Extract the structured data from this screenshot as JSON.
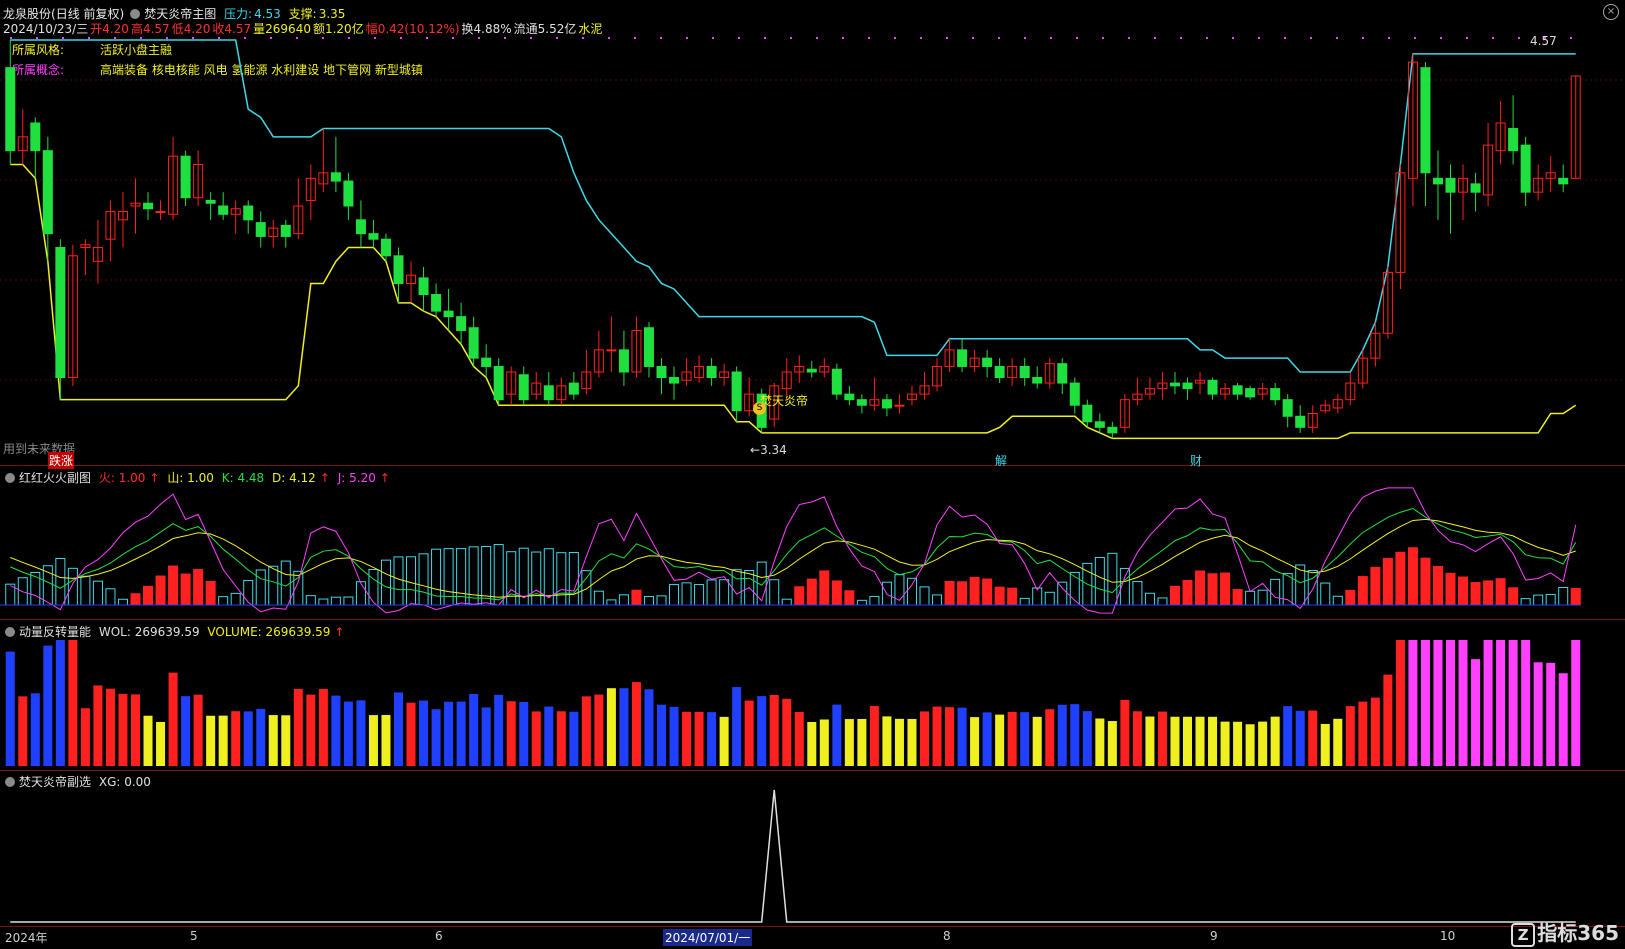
{
  "header": {
    "stock_name": "龙泉股份",
    "period": "(日线 前复权)",
    "indicator": "焚天炎帝主图",
    "pressure_label": "压力:",
    "pressure_value": "4.53",
    "support_label": "支撑:",
    "support_value": "3.35"
  },
  "quote": {
    "date": "2024/10/23/三",
    "open": "开4.20",
    "high": "高4.57",
    "low": "低4.20",
    "close": "收4.57",
    "volume": "量269640",
    "amount": "额1.20亿",
    "change": "幅0.42(10.12%)",
    "turnover": "换4.88%",
    "float": "流通5.52亿",
    "industry": "水泥"
  },
  "info": {
    "style_label": "所属风格:",
    "style_value": "活跃小盘主融",
    "concept_label": "所属概念:",
    "concept_value": "高端装备 核电核能 风电 氢能源 水利建设 地下管网 新型城镇"
  },
  "annotations": {
    "price_high": "4.57",
    "price_low": "3.34",
    "signal_text": "焚天炎帝",
    "future_data": "用到未来数据",
    "tag_zhangdie": "跌涨",
    "tag_jie": "解",
    "tag_cai": "财",
    "marker_s": "S"
  },
  "sub1": {
    "title": "红红火火副图",
    "huo": "火: 1.00",
    "shan": "山: 1.00",
    "k": "K: 4.48",
    "d": "D: 4.12",
    "j": "J: 5.20"
  },
  "sub2": {
    "title": "动量反转量能",
    "wol": "WOL: 269639.59",
    "volume": "VOLUME: 269639.59"
  },
  "sub3": {
    "title": "焚天炎帝副选",
    "xg": "XG: 0.00"
  },
  "xaxis": {
    "labels": [
      "2024年",
      "5",
      "6",
      "2024/07/01/一",
      "8",
      "9",
      "10"
    ]
  },
  "brand": {
    "logo_letter": "Z",
    "name": "指标365"
  },
  "colors": {
    "up": "#ff2020",
    "down": "#20e040",
    "cyan_line": "#40d8e8",
    "yellow_line": "#f0f020",
    "magenta": "#ff40ff",
    "border": "#7a1010"
  },
  "chart_data": {
    "type": "candlestick",
    "title": "",
    "ylim": [
      3.2,
      4.7
    ],
    "candles": [
      [
        4.6,
        4.3,
        4.7,
        4.25
      ],
      [
        4.3,
        4.35,
        4.45,
        4.25
      ],
      [
        4.4,
        4.3,
        4.42,
        4.2
      ],
      [
        4.3,
        4.0,
        4.35,
        3.9
      ],
      [
        3.95,
        3.48,
        3.98,
        3.4
      ],
      [
        3.48,
        3.92,
        3.96,
        3.45
      ],
      [
        3.95,
        3.96,
        3.98,
        3.85
      ],
      [
        3.9,
        3.95,
        4.05,
        3.82
      ],
      [
        3.98,
        4.08,
        4.12,
        3.9
      ],
      [
        4.05,
        4.08,
        4.15,
        3.95
      ],
      [
        4.1,
        4.11,
        4.2,
        4.0
      ],
      [
        4.11,
        4.09,
        4.15,
        4.05
      ],
      [
        4.08,
        4.08,
        4.12,
        4.05
      ],
      [
        4.07,
        4.28,
        4.35,
        4.05
      ],
      [
        4.28,
        4.13,
        4.3,
        4.1
      ],
      [
        4.13,
        4.25,
        4.3,
        4.1
      ],
      [
        4.12,
        4.11,
        4.15,
        4.05
      ],
      [
        4.1,
        4.07,
        4.15,
        4.05
      ],
      [
        4.07,
        4.09,
        4.12,
        4.0
      ],
      [
        4.1,
        4.05,
        4.12,
        4.0
      ],
      [
        4.04,
        3.99,
        4.08,
        3.95
      ],
      [
        3.99,
        4.02,
        4.05,
        3.95
      ],
      [
        4.03,
        3.99,
        4.05,
        3.95
      ],
      [
        4.0,
        4.1,
        4.2,
        3.98
      ],
      [
        4.12,
        4.2,
        4.25,
        4.05
      ],
      [
        4.18,
        4.22,
        4.38,
        4.15
      ],
      [
        4.22,
        4.19,
        4.35,
        4.15
      ],
      [
        4.19,
        4.1,
        4.22,
        4.05
      ],
      [
        4.05,
        4.0,
        4.12,
        3.95
      ],
      [
        4.0,
        3.98,
        4.05,
        3.95
      ],
      [
        3.98,
        3.92,
        4.0,
        3.9
      ],
      [
        3.92,
        3.82,
        3.95,
        3.75
      ],
      [
        3.82,
        3.85,
        3.9,
        3.75
      ],
      [
        3.84,
        3.78,
        3.88,
        3.72
      ],
      [
        3.78,
        3.72,
        3.82,
        3.7
      ],
      [
        3.72,
        3.7,
        3.8,
        3.65
      ],
      [
        3.7,
        3.65,
        3.75,
        3.6
      ],
      [
        3.66,
        3.55,
        3.7,
        3.52
      ],
      [
        3.55,
        3.52,
        3.6,
        3.48
      ],
      [
        3.52,
        3.4,
        3.55,
        3.38
      ],
      [
        3.42,
        3.5,
        3.52,
        3.38
      ],
      [
        3.49,
        3.4,
        3.52,
        3.38
      ],
      [
        3.42,
        3.46,
        3.5,
        3.4
      ],
      [
        3.45,
        3.4,
        3.5,
        3.38
      ],
      [
        3.4,
        3.45,
        3.48,
        3.38
      ],
      [
        3.46,
        3.42,
        3.5,
        3.4
      ],
      [
        3.44,
        3.5,
        3.58,
        3.42
      ],
      [
        3.5,
        3.58,
        3.65,
        3.48
      ],
      [
        3.58,
        3.58,
        3.7,
        3.5
      ],
      [
        3.58,
        3.5,
        3.65,
        3.45
      ],
      [
        3.5,
        3.65,
        3.7,
        3.48
      ],
      [
        3.66,
        3.52,
        3.68,
        3.48
      ],
      [
        3.52,
        3.48,
        3.55,
        3.42
      ],
      [
        3.48,
        3.46,
        3.52,
        3.4
      ],
      [
        3.47,
        3.5,
        3.55,
        3.45
      ],
      [
        3.48,
        3.52,
        3.56,
        3.46
      ],
      [
        3.52,
        3.48,
        3.55,
        3.45
      ],
      [
        3.48,
        3.5,
        3.53,
        3.45
      ],
      [
        3.5,
        3.36,
        3.52,
        3.32
      ],
      [
        3.36,
        3.42,
        3.48,
        3.34
      ],
      [
        3.42,
        3.3,
        3.44,
        3.28
      ],
      [
        3.33,
        3.45,
        3.46,
        3.3
      ],
      [
        3.44,
        3.5,
        3.55,
        3.4
      ],
      [
        3.5,
        3.52,
        3.56,
        3.46
      ],
      [
        3.51,
        3.5,
        3.54,
        3.48
      ],
      [
        3.5,
        3.52,
        3.55,
        3.48
      ],
      [
        3.51,
        3.42,
        3.53,
        3.4
      ],
      [
        3.42,
        3.4,
        3.45,
        3.38
      ],
      [
        3.4,
        3.38,
        3.42,
        3.35
      ],
      [
        3.38,
        3.4,
        3.48,
        3.36
      ],
      [
        3.4,
        3.37,
        3.42,
        3.34
      ],
      [
        3.38,
        3.38,
        3.42,
        3.35
      ],
      [
        3.4,
        3.42,
        3.45,
        3.38
      ],
      [
        3.42,
        3.45,
        3.5,
        3.4
      ],
      [
        3.45,
        3.52,
        3.55,
        3.43
      ],
      [
        3.52,
        3.58,
        3.62,
        3.5
      ],
      [
        3.58,
        3.52,
        3.62,
        3.5
      ],
      [
        3.52,
        3.55,
        3.58,
        3.5
      ],
      [
        3.55,
        3.52,
        3.58,
        3.48
      ],
      [
        3.52,
        3.48,
        3.55,
        3.46
      ],
      [
        3.48,
        3.52,
        3.55,
        3.45
      ],
      [
        3.52,
        3.48,
        3.55,
        3.45
      ],
      [
        3.48,
        3.46,
        3.52,
        3.44
      ],
      [
        3.46,
        3.53,
        3.55,
        3.44
      ],
      [
        3.53,
        3.46,
        3.55,
        3.42
      ],
      [
        3.46,
        3.38,
        3.48,
        3.35
      ],
      [
        3.38,
        3.32,
        3.4,
        3.3
      ],
      [
        3.32,
        3.3,
        3.35,
        3.28
      ],
      [
        3.3,
        3.28,
        3.32,
        3.26
      ],
      [
        3.3,
        3.4,
        3.42,
        3.28
      ],
      [
        3.4,
        3.42,
        3.48,
        3.38
      ],
      [
        3.42,
        3.44,
        3.48,
        3.4
      ],
      [
        3.44,
        3.46,
        3.5,
        3.4
      ],
      [
        3.46,
        3.45,
        3.5,
        3.42
      ],
      [
        3.46,
        3.44,
        3.48,
        3.4
      ],
      [
        3.46,
        3.47,
        3.5,
        3.42
      ],
      [
        3.47,
        3.42,
        3.48,
        3.4
      ],
      [
        3.42,
        3.44,
        3.46,
        3.4
      ],
      [
        3.45,
        3.42,
        3.46,
        3.4
      ],
      [
        3.44,
        3.41,
        3.45,
        3.4
      ],
      [
        3.42,
        3.44,
        3.46,
        3.4
      ],
      [
        3.44,
        3.4,
        3.46,
        3.38
      ],
      [
        3.4,
        3.34,
        3.42,
        3.3
      ],
      [
        3.34,
        3.3,
        3.38,
        3.28
      ],
      [
        3.3,
        3.35,
        3.38,
        3.28
      ],
      [
        3.36,
        3.38,
        3.4,
        3.35
      ],
      [
        3.37,
        3.4,
        3.42,
        3.35
      ],
      [
        3.4,
        3.46,
        3.5,
        3.38
      ],
      [
        3.46,
        3.55,
        3.58,
        3.44
      ],
      [
        3.55,
        3.64,
        3.68,
        3.52
      ],
      [
        3.64,
        3.86,
        3.88,
        3.62
      ],
      [
        3.86,
        4.22,
        4.25,
        3.8
      ],
      [
        4.2,
        4.62,
        4.65,
        4.1
      ],
      [
        4.6,
        4.22,
        4.62,
        4.1
      ],
      [
        4.2,
        4.18,
        4.3,
        4.05
      ],
      [
        4.2,
        4.15,
        4.25,
        4.0
      ],
      [
        4.15,
        4.2,
        4.25,
        4.05
      ],
      [
        4.18,
        4.15,
        4.22,
        4.08
      ],
      [
        4.14,
        4.32,
        4.4,
        4.1
      ],
      [
        4.3,
        4.4,
        4.48,
        4.25
      ],
      [
        4.38,
        4.3,
        4.5,
        4.25
      ],
      [
        4.32,
        4.15,
        4.35,
        4.1
      ],
      [
        4.15,
        4.2,
        4.25,
        4.12
      ],
      [
        4.2,
        4.22,
        4.28,
        4.15
      ],
      [
        4.2,
        4.18,
        4.25,
        4.15
      ],
      [
        4.2,
        4.57,
        4.57,
        4.2
      ]
    ]
  }
}
